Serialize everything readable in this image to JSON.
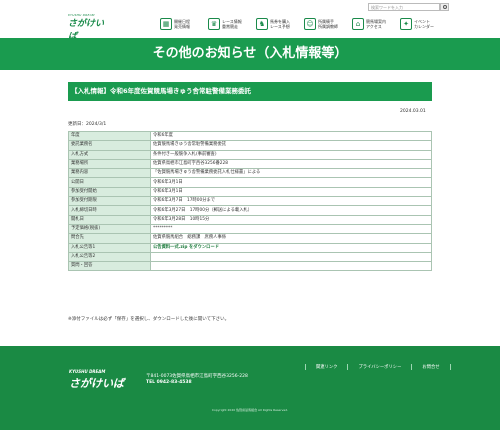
{
  "header": {
    "logo_top": "KYUSHU DREAM",
    "logo_main": "さがけいば",
    "search_placeholder": "検索ワードを入力",
    "nav": [
      {
        "label": "開催日程\n発売情報",
        "icon": "calendar-icon"
      },
      {
        "label": "レース情報\n重賞競走",
        "icon": "trophy-icon"
      },
      {
        "label": "馬券を購入\nレース予想",
        "icon": "ticket-icon"
      },
      {
        "label": "所属騎手\n所属調教師",
        "icon": "jockey-icon"
      },
      {
        "label": "競馬場案内\nアクセス",
        "icon": "map-icon"
      },
      {
        "label": "イベント\nカレンダー",
        "icon": "event-icon"
      }
    ]
  },
  "page_title": "その他のお知らせ（入札情報等）",
  "notice": {
    "title": "【入札情報】令和6年度佐賀競馬場きゅう舎常駐警備業務委託",
    "date": "2024.03.01",
    "updated": "更新日：2024/3/1"
  },
  "table": [
    {
      "key": "年度",
      "value": "令和6年度"
    },
    {
      "key": "委託業務名",
      "value": "佐賀競馬場きゅう舎常駐警備業務委託"
    },
    {
      "key": "入札方式",
      "value": "条件付き一般競争入札(事前審査)"
    },
    {
      "key": "業務場所",
      "value": "佐賀県鳥栖市江島町字西谷3256番228"
    },
    {
      "key": "業務内容",
      "value": "「佐賀競馬場きゅう舎警備業務委託入札仕様書」による"
    },
    {
      "key": "公開日",
      "value": "令和6年3月1日"
    },
    {
      "key": "参加受付開始",
      "value": "令和6年3月1日"
    },
    {
      "key": "参加受付期限",
      "value": "令和6年3月7日　17時00分まで"
    },
    {
      "key": "入札締切日時",
      "value": "令和6年3月27日　17時00分（郵送による載入札）"
    },
    {
      "key": "開札日",
      "value": "令和6年3月28日　10時15分"
    },
    {
      "key": "予定価格(税抜)",
      "value": "*********"
    },
    {
      "key": "問合先",
      "value": "佐賀県競馬組合　総務課　庶務人事係"
    },
    {
      "key": "入札公告等1",
      "value": "公告資料一式.zip をダウンロード",
      "link": true
    },
    {
      "key": "入札公告等2",
      "value": ""
    },
    {
      "key": "質問・回答",
      "value": ""
    }
  ],
  "note": "※添付ファイルは必ず「保存」を選択し、ダウンロードした後に開いて下さい。",
  "footer": {
    "logo_top": "KYUSHU DREAM",
    "logo_main": "さがけいば",
    "address": "〒841-0073佐賀県鳥栖市江島町字西谷3256-228",
    "tel": "TEL 0942-83-4538",
    "links": [
      "関連リンク",
      "プライバシーポリシー",
      "お問合せ"
    ],
    "copyright": "Copyright 2020 佐賀県競馬組合 All Rights Reserved."
  }
}
